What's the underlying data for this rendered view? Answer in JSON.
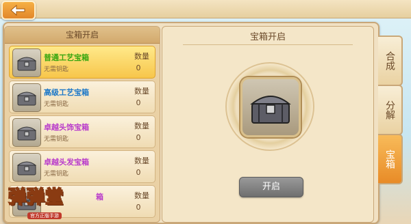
{
  "header": {
    "back_icon": "back-arrow-icon"
  },
  "left_panel": {
    "title": "宝箱开启",
    "items": [
      {
        "name": "普通工艺宝箱",
        "sub": "无需钥匙",
        "qty_label": "数量",
        "qty": "0",
        "color": "green",
        "selected": true
      },
      {
        "name": "高级工艺宝箱",
        "sub": "无需钥匙",
        "qty_label": "数量",
        "qty": "0",
        "color": "blue",
        "selected": false
      },
      {
        "name": "卓越头饰宝箱",
        "sub": "无需钥匙",
        "qty_label": "数量",
        "qty": "0",
        "color": "purple",
        "selected": false
      },
      {
        "name": "卓越头发宝箱",
        "sub": "无需钥匙",
        "qty_label": "数量",
        "qty": "0",
        "color": "purple",
        "selected": false
      },
      {
        "name": "箱",
        "sub": "",
        "qty_label": "数量",
        "qty": "0",
        "color": "purple",
        "selected": false
      }
    ]
  },
  "right_panel": {
    "title": "宝箱开启",
    "open_button": "开启"
  },
  "tabs": [
    {
      "label": "合成"
    },
    {
      "label": "分解"
    },
    {
      "label": "宝箱"
    }
  ],
  "logo": {
    "text": "弹弹堂",
    "sub": "官方正版手游"
  },
  "colors": {
    "accent": "#f0a13a",
    "selected": "#f7c64b",
    "frame": "#f1e1c3"
  }
}
